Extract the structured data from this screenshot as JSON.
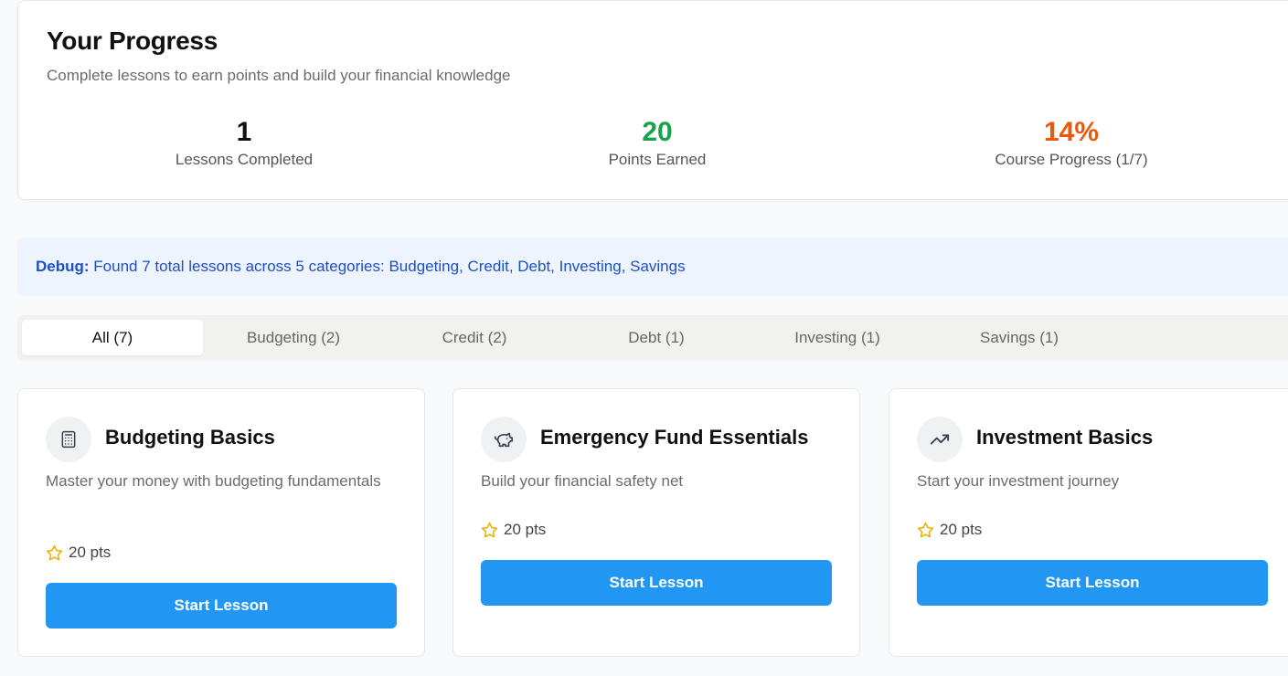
{
  "progress": {
    "title": "Your Progress",
    "subtitle": "Complete lessons to earn points and build your financial knowledge",
    "stats": [
      {
        "value": "1",
        "label": "Lessons Completed",
        "color": "#111111"
      },
      {
        "value": "20",
        "label": "Points Earned",
        "color": "#16a34a"
      },
      {
        "value": "14%",
        "label": "Course Progress (1/7)",
        "color": "#ea580c"
      }
    ]
  },
  "debug": {
    "prefix": "Debug:",
    "message": "Found 7 total lessons across 5 categories: Budgeting, Credit, Debt, Investing, Savings"
  },
  "tabs": [
    {
      "label": "All (7)",
      "active": true
    },
    {
      "label": "Budgeting (2)",
      "active": false
    },
    {
      "label": "Credit (2)",
      "active": false
    },
    {
      "label": "Debt (1)",
      "active": false
    },
    {
      "label": "Investing (1)",
      "active": false
    },
    {
      "label": "Savings (1)",
      "active": false
    }
  ],
  "lessons": [
    {
      "icon": "calculator-icon",
      "title": "Budgeting Basics",
      "description": "Master your money with budgeting fundamentals",
      "points": "20 pts",
      "button": "Start Lesson"
    },
    {
      "icon": "piggy-bank-icon",
      "title": "Emergency Fund Essentials",
      "description": "Build your financial safety net",
      "points": "20 pts",
      "button": "Start Lesson"
    },
    {
      "icon": "trending-up-icon",
      "title": "Investment Basics",
      "description": "Start your investment journey",
      "points": "20 pts",
      "button": "Start Lesson"
    }
  ],
  "colors": {
    "accent": "#2196f3",
    "star": "#eab308",
    "debug_text": "#1e4fc7"
  }
}
